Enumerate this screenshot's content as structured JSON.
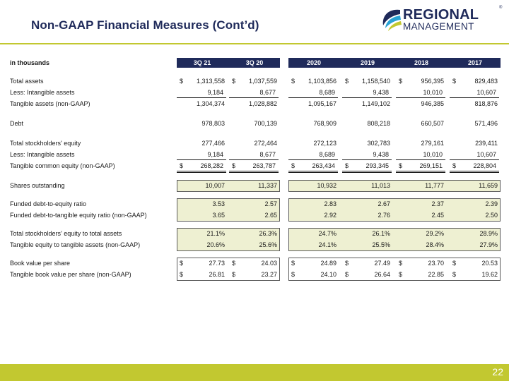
{
  "title": "Non-GAAP Financial Measures (Cont’d)",
  "logo": {
    "line1": "REGIONAL",
    "line2": "MANAGEMENT",
    "mark": "®"
  },
  "table": {
    "label_header": "in thousands",
    "columns": [
      "3Q 21",
      "3Q 20",
      "2020",
      "2019",
      "2018",
      "2017"
    ],
    "rows": [
      {
        "label": "Total assets",
        "cur": [
          "$",
          "$",
          "$",
          "$",
          "$",
          "$"
        ],
        "values": [
          "1,313,558",
          "1,037,559",
          "1,103,856",
          "1,158,540",
          "956,395",
          "829,483"
        ]
      },
      {
        "label": "Less: Intangible assets",
        "cur": [
          "",
          "",
          "",
          "",
          "",
          ""
        ],
        "values": [
          "9,184",
          "8,677",
          "8,689",
          "9,438",
          "10,010",
          "10,607"
        ]
      },
      {
        "label": "Tangible assets (non-GAAP)",
        "cur": [
          "",
          "",
          "",
          "",
          "",
          ""
        ],
        "values": [
          "1,304,374",
          "1,028,882",
          "1,095,167",
          "1,149,102",
          "946,385",
          "818,876"
        ]
      },
      {
        "label": "Debt",
        "cur": [
          "",
          "",
          "",
          "",
          "",
          ""
        ],
        "values": [
          "978,803",
          "700,139",
          "768,909",
          "808,218",
          "660,507",
          "571,496"
        ]
      },
      {
        "label": "Total stockholders' equity",
        "cur": [
          "",
          "",
          "",
          "",
          "",
          ""
        ],
        "values": [
          "277,466",
          "272,464",
          "272,123",
          "302,783",
          "279,161",
          "239,411"
        ]
      },
      {
        "label": "Less: Intangible assets",
        "cur": [
          "",
          "",
          "",
          "",
          "",
          ""
        ],
        "values": [
          "9,184",
          "8,677",
          "8,689",
          "9,438",
          "10,010",
          "10,607"
        ]
      },
      {
        "label": "Tangible common equity (non-GAAP)",
        "cur": [
          "$",
          "$",
          "$",
          "$",
          "$",
          "$"
        ],
        "values": [
          "268,282",
          "263,787",
          "263,434",
          "293,345",
          "269,151",
          "228,804"
        ]
      },
      {
        "label": "Shares outstanding",
        "cur": [
          "",
          "",
          "",
          "",
          "",
          ""
        ],
        "values": [
          "10,007",
          "11,337",
          "10,932",
          "11,013",
          "11,777",
          "11,659"
        ]
      },
      {
        "label": "Funded debt-to-equity ratio",
        "cur": [
          "",
          "",
          "",
          "",
          "",
          ""
        ],
        "values": [
          "3.53",
          "2.57",
          "2.83",
          "2.67",
          "2.37",
          "2.39"
        ]
      },
      {
        "label": "Funded debt-to-tangible equity ratio (non-GAAP)",
        "cur": [
          "",
          "",
          "",
          "",
          "",
          ""
        ],
        "values": [
          "3.65",
          "2.65",
          "2.92",
          "2.76",
          "2.45",
          "2.50"
        ]
      },
      {
        "label": "Total stockholders' equity to total assets",
        "cur": [
          "",
          "",
          "",
          "",
          "",
          ""
        ],
        "values": [
          "21.1%",
          "26.3%",
          "24.7%",
          "26.1%",
          "29.2%",
          "28.9%"
        ]
      },
      {
        "label": "Tangible equity to tangible assets (non-GAAP)",
        "cur": [
          "",
          "",
          "",
          "",
          "",
          ""
        ],
        "values": [
          "20.6%",
          "25.6%",
          "24.1%",
          "25.5%",
          "28.4%",
          "27.9%"
        ]
      },
      {
        "label": "Book value per share",
        "cur": [
          "$",
          "$",
          "$",
          "$",
          "$",
          "$"
        ],
        "values": [
          "27.73",
          "24.03",
          "24.89",
          "27.49",
          "23.70",
          "20.53"
        ]
      },
      {
        "label": "Tangible book value per share (non-GAAP)",
        "cur": [
          "$",
          "$",
          "$",
          "$",
          "$",
          "$"
        ],
        "values": [
          "26.81",
          "23.27",
          "24.10",
          "26.64",
          "22.85",
          "19.62"
        ]
      }
    ]
  },
  "page_number": "22",
  "colors": {
    "navy": "#1f2a5a",
    "lime": "#c2c830",
    "highlight": "#eef0d2"
  }
}
